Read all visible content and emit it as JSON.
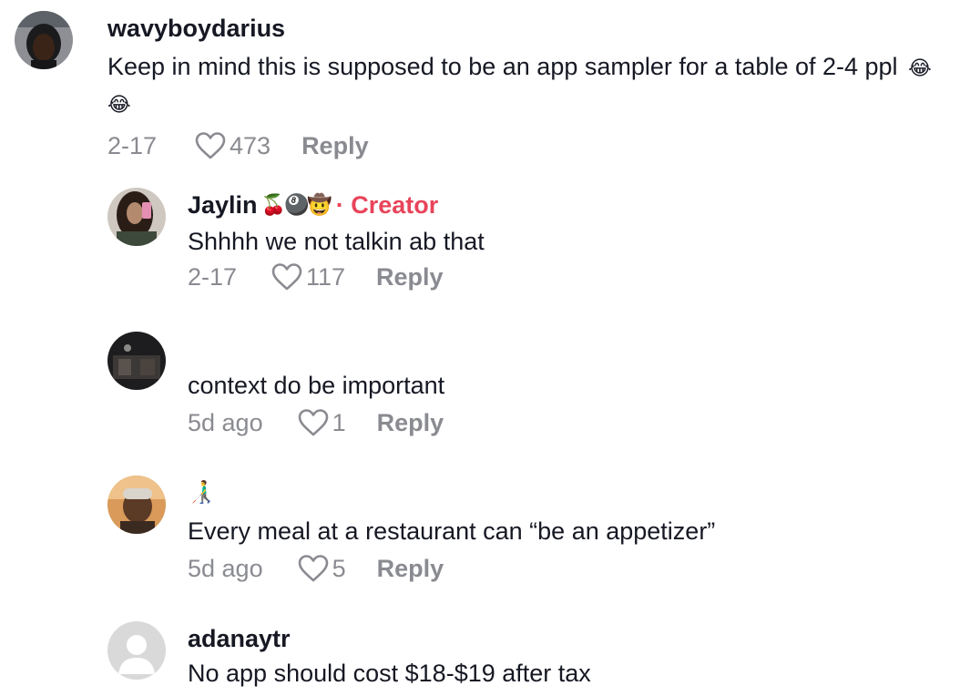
{
  "comments": [
    {
      "username": "wavyboydarius",
      "text": "Keep in mind this is supposed to be an app sampler for a table of 2-4 ppl",
      "text_emoji": "😂😂",
      "date": "2-17",
      "likes": "473",
      "reply_label": "Reply"
    },
    {
      "username": "Jaylin",
      "name_emoji": "🍒🎱🤠",
      "badge_sep": "·",
      "badge": "Creator",
      "text": "Shhhh we not talkin ab that",
      "date": "2-17",
      "likes": "117",
      "reply_label": "Reply"
    },
    {
      "username": "",
      "text": "context do be important",
      "date": "5d ago",
      "likes": "1",
      "reply_label": "Reply"
    },
    {
      "username": "",
      "name_emoji": "👨‍🦯",
      "text": "Every meal at a restaurant can “be an appetizer”",
      "date": "5d ago",
      "likes": "5",
      "reply_label": "Reply"
    },
    {
      "username": "adanaytr",
      "text": "No app should cost $18-$19 after tax"
    }
  ],
  "colors": {
    "creator_badge": "#e8445a",
    "meta_gray": "#8a8b91",
    "text": "#161823"
  },
  "icons": {
    "like": "heart-outline-icon",
    "default_avatar": "person-silhouette-icon"
  }
}
